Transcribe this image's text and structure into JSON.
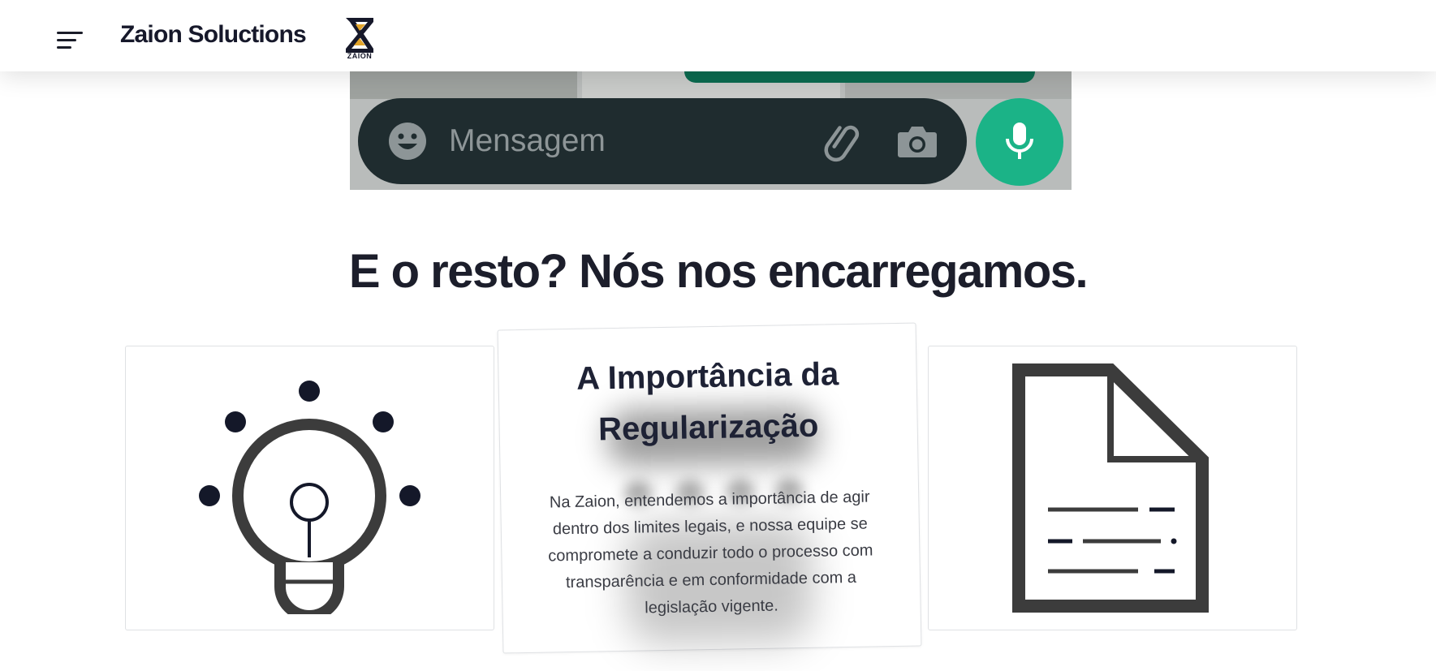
{
  "header": {
    "brand_name": "Zaion Soluctions",
    "logo_text": "ZAION",
    "menu_icon": "hamburger-menu-icon"
  },
  "whatsapp_image": {
    "placeholder": "Mensagem",
    "icons": [
      "emoji-icon",
      "paperclip-icon",
      "camera-icon",
      "microphone-icon"
    ],
    "colors": {
      "bar": "#1f2c2f",
      "mic": "#1bb387",
      "green_top": "#0b6b50"
    }
  },
  "section": {
    "title": "E o resto? Nós nos encarregamos."
  },
  "cards": [
    {
      "icon": "lightbulb-icon"
    },
    {
      "title": "A Importância da Regularização",
      "text": "Na Zaion, entendemos a importância de agir dentro dos limites legais, e nossa equipe se compromete a conduzir todo o processo com transparência e em conformidade com a legislação vigente."
    },
    {
      "icon": "document-icon"
    }
  ],
  "colors": {
    "dark": "#1c1e2b",
    "icon_gray": "#3c3c3c",
    "navy_dot": "#141829"
  }
}
